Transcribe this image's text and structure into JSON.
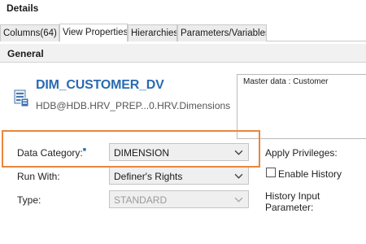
{
  "title": "Details",
  "tabs": [
    {
      "label": "Columns(64)"
    },
    {
      "label": "View Properties"
    },
    {
      "label": "Hierarchies"
    },
    {
      "label": "Parameters/Variables"
    }
  ],
  "section": {
    "title": "General"
  },
  "object": {
    "name": "DIM_CUSTOMER_DV",
    "path": "HDB@HDB.HRV_PREP...0.HRV.Dimensions",
    "icon": "dimension-view-icon"
  },
  "master_data": "Master data : Customer",
  "fields": {
    "data_category": {
      "label": "Data Category:",
      "value": "DIMENSION"
    },
    "run_with": {
      "label": "Run With:",
      "value": "Definer's Rights"
    },
    "type": {
      "label": "Type:",
      "value": "STANDARD"
    }
  },
  "right": {
    "apply_privileges": "Apply Privileges:",
    "enable_history": "Enable History",
    "history_input": "History Input Parameter:"
  },
  "colors": {
    "accent": "#2a6bb0",
    "highlight": "#e8873e"
  }
}
